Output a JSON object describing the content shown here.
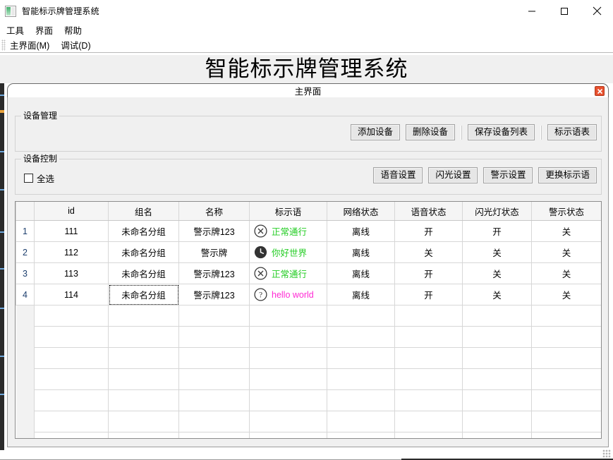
{
  "window": {
    "title": "智能标示牌管理系统",
    "icon": "picture-icon",
    "controls": {
      "minimize": "minimize-icon",
      "maximize": "maximize-icon",
      "close": "close-icon"
    }
  },
  "menubar": {
    "items": [
      {
        "label": "工具"
      },
      {
        "label": "界面"
      },
      {
        "label": "帮助"
      }
    ]
  },
  "toolbar": {
    "items": [
      {
        "label": "主界面(M)"
      },
      {
        "label": "调试(D)"
      }
    ]
  },
  "heading": "智能标示牌管理系统",
  "tab": {
    "label": "主界面",
    "close_icon": "close-icon",
    "close_color": "#e8512f"
  },
  "device_manage": {
    "legend": "设备管理",
    "buttons": [
      {
        "label": "添加设备"
      },
      {
        "label": "删除设备"
      },
      {
        "label": "保存设备列表"
      },
      {
        "label": "标示语表"
      }
    ]
  },
  "device_control": {
    "legend": "设备控制",
    "select_all": {
      "label": "全选",
      "checked": false
    },
    "buttons": [
      {
        "label": "语音设置"
      },
      {
        "label": "闪光设置"
      },
      {
        "label": "警示设置"
      },
      {
        "label": "更换标示语"
      }
    ]
  },
  "table": {
    "gutter_header": "",
    "columns": [
      "id",
      "组名",
      "名称",
      "标示语",
      "网络状态",
      "语音状态",
      "闪光灯状态",
      "警示状态"
    ],
    "rows": [
      {
        "num": "1",
        "id": "111",
        "group": "未命名分组",
        "name": "警示牌123",
        "slogan": "正常通行",
        "slogan_icon": "circle-x-icon",
        "slogan_color": "#22cc22",
        "network": "离线",
        "voice": "开",
        "flash": "开",
        "warn": "关",
        "focus_cell": null
      },
      {
        "num": "2",
        "id": "112",
        "group": "未命名分组",
        "name": "警示牌",
        "slogan": "你好世界",
        "slogan_icon": "clock-filled-icon",
        "slogan_color": "#22cc22",
        "network": "离线",
        "voice": "关",
        "flash": "关",
        "warn": "关",
        "focus_cell": null
      },
      {
        "num": "3",
        "id": "113",
        "group": "未命名分组",
        "name": "警示牌123",
        "slogan": "正常通行",
        "slogan_icon": "circle-x-icon",
        "slogan_color": "#22cc22",
        "network": "离线",
        "voice": "开",
        "flash": "关",
        "warn": "关",
        "focus_cell": null
      },
      {
        "num": "4",
        "id": "114",
        "group": "未命名分组",
        "name": "警示牌123",
        "slogan": "hello world",
        "slogan_icon": "circle-question-icon",
        "slogan_color": "#ff2ad4",
        "network": "离线",
        "voice": "开",
        "flash": "关",
        "warn": "关",
        "focus_cell": "group"
      }
    ]
  }
}
